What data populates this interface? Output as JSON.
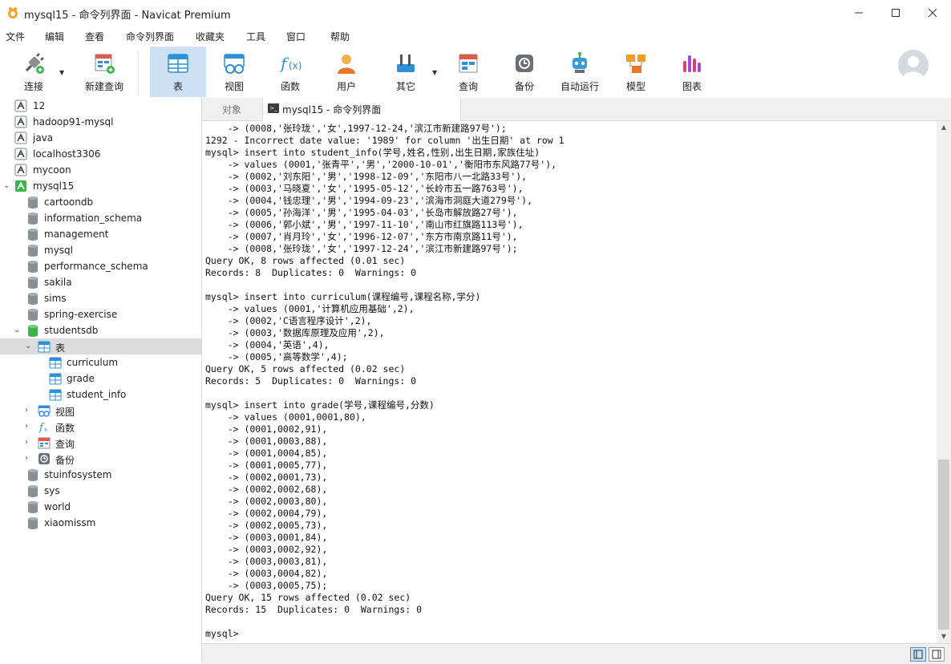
{
  "window": {
    "title": "mysql15 - 命令列界面 - Navicat Premium"
  },
  "menu": [
    "文件",
    "编辑",
    "查看",
    "命令列界面",
    "收藏夹",
    "工具",
    "窗口",
    "帮助"
  ],
  "toolbar": {
    "connect": "连接",
    "new_query": "新建查询",
    "table": "表",
    "view": "视图",
    "function": "函数",
    "user": "用户",
    "other": "其它",
    "query": "查询",
    "backup": "备份",
    "automation": "自动运行",
    "model": "模型",
    "chart": "图表"
  },
  "tree": {
    "connections_top": [
      "12",
      "hadoop91-mysql",
      "java",
      "localhost3306",
      "mycoon"
    ],
    "active_connection": "mysql15",
    "databases_before": [
      "cartoondb",
      "information_schema",
      "management",
      "mysql",
      "performance_schema",
      "sakila",
      "sims",
      "spring-exercise"
    ],
    "open_db": "studentsdb",
    "tables_group": "表",
    "tables": [
      "curriculum",
      "grade",
      "student_info"
    ],
    "groups": [
      "视图",
      "函数",
      "查询",
      "备份"
    ],
    "databases_after": [
      "stuinfosystem",
      "sys",
      "world",
      "xiaomissm"
    ]
  },
  "tabs": {
    "objects": "对象",
    "console": "mysql15 - 命令列界面"
  },
  "console": {
    "lines": [
      "    -> (0008,'张玲珑','女',1997-12-24,'滨江市新建路97号');",
      "1292 - Incorrect date value: '1989' for column '出生日期' at row 1",
      "mysql> insert into student_info(学号,姓名,性别,出生日期,家族住址)",
      "    -> values (0001,'张青平','男','2000-10-01','衡阳市东风路77号'),",
      "    -> (0002,'刘东阳','男','1998-12-09','东阳市八一北路33号'),",
      "    -> (0003,'马晓夏','女','1995-05-12','长岭市五一路763号'),",
      "    -> (0004,'钱忠理','男','1994-09-23','滨海市洞庭大道279号'),",
      "    -> (0005,'孙海洋','男','1995-04-03','长岛市解放路27号'),",
      "    -> (0006,'郭小斌','男','1997-11-10','南山市红旗路113号'),",
      "    -> (0007,'肖月玲','女','1996-12-07','东方市南京路11号'),",
      "    -> (0008,'张玲珑','女','1997-12-24','滨江市新建路97号');",
      "Query OK, 8 rows affected (0.01 sec)",
      "Records: 8  Duplicates: 0  Warnings: 0",
      "",
      "mysql> insert into curriculum(课程编号,课程名称,学分)",
      "    -> values (0001,'计算机应用基础',2),",
      "    -> (0002,'C语言程序设计',2),",
      "    -> (0003,'数据库原理及应用',2),",
      "    -> (0004,'英语',4),",
      "    -> (0005,'高等数学',4);",
      "Query OK, 5 rows affected (0.02 sec)",
      "Records: 5  Duplicates: 0  Warnings: 0",
      "",
      "mysql> insert into grade(学号,课程编号,分数)",
      "    -> values (0001,0001,80),",
      "    -> (0001,0002,91),",
      "    -> (0001,0003,88),",
      "    -> (0001,0004,85),",
      "    -> (0001,0005,77),",
      "    -> (0002,0001,73),",
      "    -> (0002,0002,68),",
      "    -> (0002,0003,80),",
      "    -> (0002,0004,79),",
      "    -> (0002,0005,73),",
      "    -> (0003,0001,84),",
      "    -> (0003,0002,92),",
      "    -> (0003,0003,81),",
      "    -> (0003,0004,82),",
      "    -> (0003,0005,75);",
      "Query OK, 15 rows affected (0.02 sec)",
      "Records: 15  Duplicates: 0  Warnings: 0",
      "",
      "mysql>"
    ]
  },
  "colors": {
    "active_tool": "#cce2f4",
    "selected_row": "#dcdcdc",
    "accent_blue": "#2f8fd8"
  }
}
